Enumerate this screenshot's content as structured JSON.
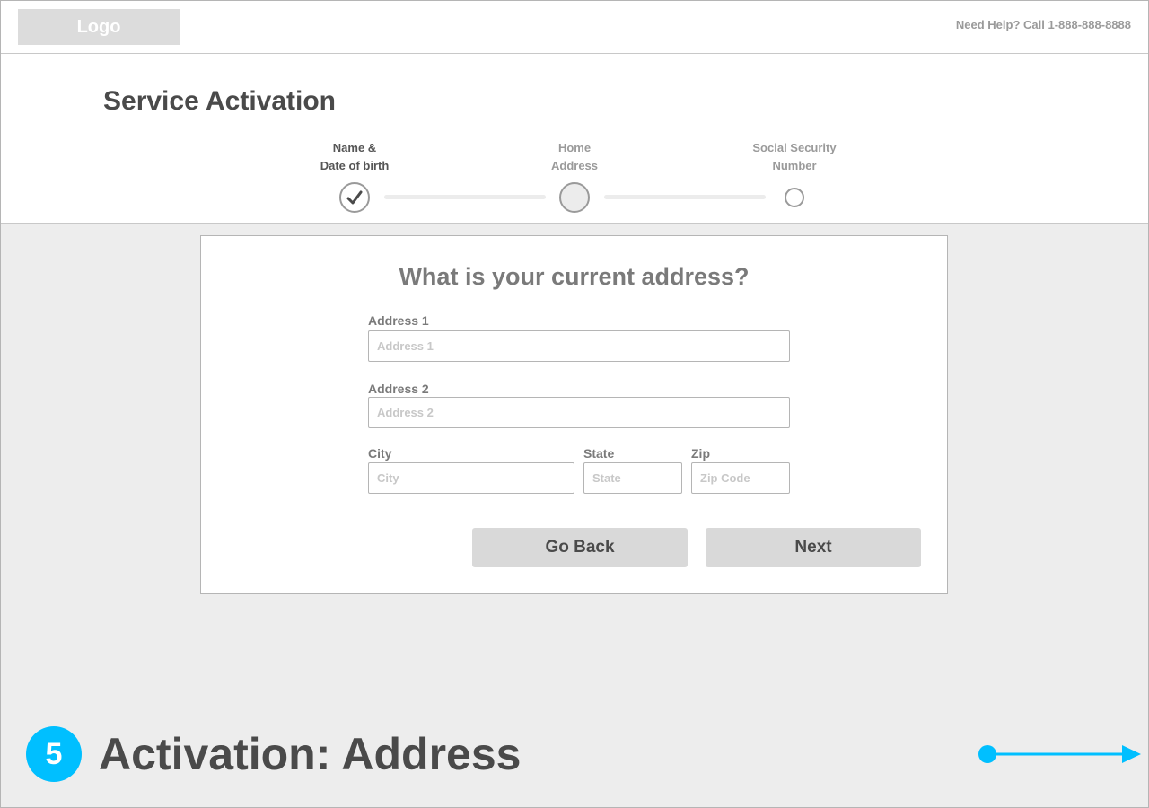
{
  "header": {
    "logo": "Logo",
    "help_text": "Need Help? Call 1-888-888-8888"
  },
  "page": {
    "title": "Service Activation"
  },
  "stepper": {
    "steps": [
      {
        "line1": "Name &",
        "line2": "Date of birth",
        "state": "complete"
      },
      {
        "line1": "Home",
        "line2": "Address",
        "state": "current"
      },
      {
        "line1": "Social Security",
        "line2": "Number",
        "state": "upcoming"
      }
    ]
  },
  "form": {
    "title": "What is your current address?",
    "address1": {
      "label": "Address 1",
      "placeholder": "Address 1",
      "value": ""
    },
    "address2": {
      "label": "Address 2",
      "placeholder": "Address 2",
      "value": ""
    },
    "city": {
      "label": "City",
      "placeholder": "City",
      "value": ""
    },
    "state": {
      "label": "State",
      "placeholder": "State",
      "value": ""
    },
    "zip": {
      "label": "Zip",
      "placeholder": "Zip Code",
      "value": ""
    },
    "back_label": "Go Back",
    "next_label": "Next"
  },
  "annotation": {
    "number": "5",
    "title": "Activation: Address",
    "accent_color": "#00bfff"
  },
  "icons": {
    "step_complete": "checkmark-icon",
    "flow_arrow": "arrow-right-icon"
  }
}
